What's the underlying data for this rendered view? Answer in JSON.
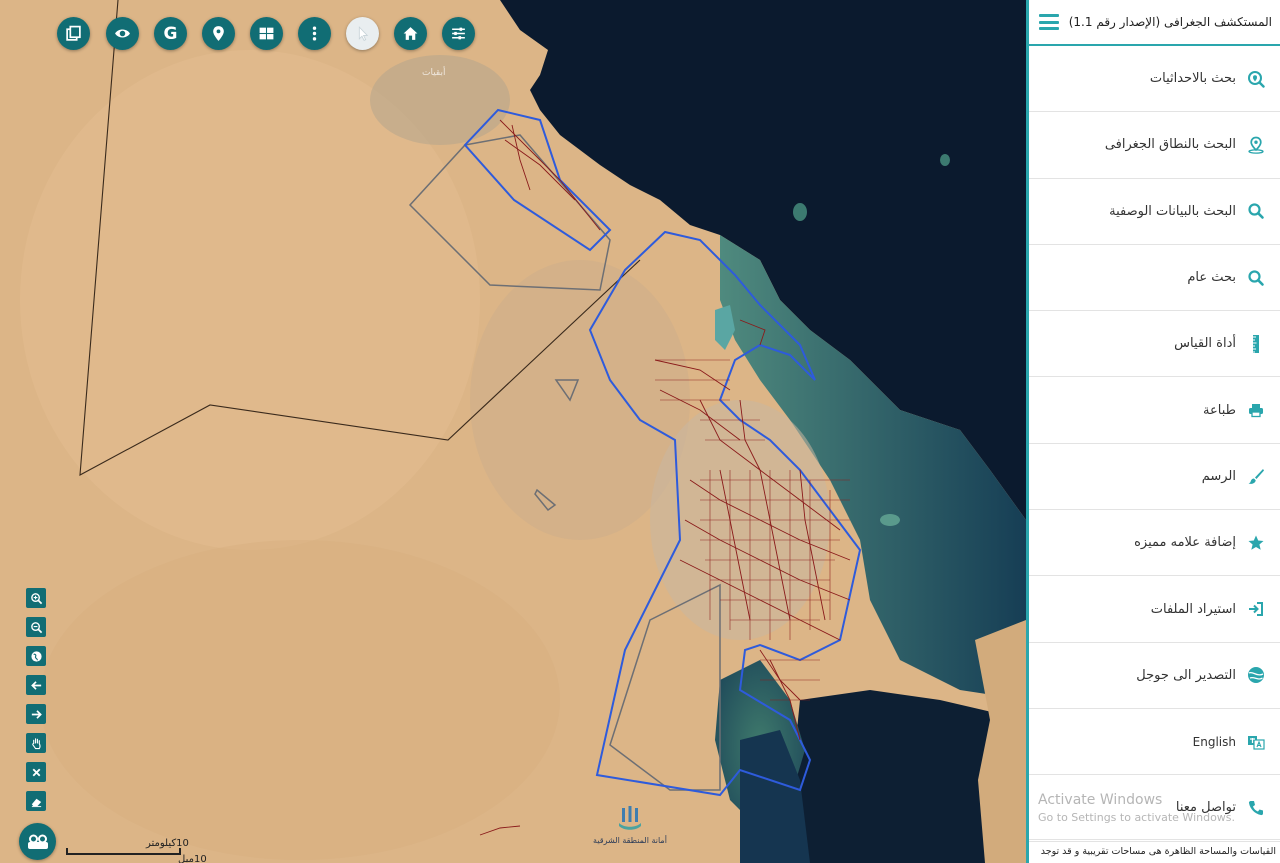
{
  "app": {
    "title": "المستكشف الجغرافى (الإصدار رقم 1.1)"
  },
  "top_toolbar": [
    {
      "name": "layers-copy",
      "icon": "layers-copy-icon"
    },
    {
      "name": "visibility",
      "icon": "eye-icon"
    },
    {
      "name": "google",
      "icon": "google-g-icon",
      "label": "G"
    },
    {
      "name": "location",
      "icon": "map-pin-icon"
    },
    {
      "name": "layout",
      "icon": "grid-icon"
    },
    {
      "name": "more",
      "icon": "vertical-dots-icon"
    },
    {
      "name": "pointer",
      "icon": "cursor-icon"
    },
    {
      "name": "home",
      "icon": "home-icon"
    },
    {
      "name": "settings",
      "icon": "sliders-icon"
    }
  ],
  "side_toolbar": [
    {
      "name": "zoom-in",
      "icon": "zoom-in-icon"
    },
    {
      "name": "zoom-out",
      "icon": "zoom-out-icon"
    },
    {
      "name": "full-extent",
      "icon": "globe-icon"
    },
    {
      "name": "previous-extent",
      "icon": "arrow-left-icon"
    },
    {
      "name": "next-extent",
      "icon": "arrow-right-icon"
    },
    {
      "name": "pan",
      "icon": "hand-icon"
    },
    {
      "name": "clear",
      "icon": "close-icon"
    },
    {
      "name": "eraser",
      "icon": "eraser-icon"
    }
  ],
  "map": {
    "scale_km": "10كيلومتر",
    "scale_mi": "10ميل",
    "logo_text": "أمانة المنطقة الشرقية",
    "label_district": "أبقيات"
  },
  "menu": [
    {
      "label": "بحث بالاحداثيات",
      "icon": "search-location-icon"
    },
    {
      "label": "البحث بالنطاق الجغرافى",
      "icon": "map-pin-area-icon"
    },
    {
      "label": "البحث بالبيانات الوصفية",
      "icon": "search-icon"
    },
    {
      "label": "بحث عام",
      "icon": "search-icon"
    },
    {
      "label": "أداة القياس",
      "icon": "ruler-icon"
    },
    {
      "label": "طباعة",
      "icon": "print-icon"
    },
    {
      "label": "الرسم",
      "icon": "brush-icon"
    },
    {
      "label": "إضافة علامه مميزه",
      "icon": "star-icon"
    },
    {
      "label": "استيراد الملفات",
      "icon": "import-icon"
    },
    {
      "label": "التصدير الى جوجل",
      "icon": "globe-earth-icon"
    },
    {
      "label": "English",
      "icon": "translate-icon"
    },
    {
      "label": "تواصل معنا",
      "icon": "phone-icon"
    }
  ],
  "windows_notice": {
    "line1": "Activate Windows",
    "line2": "Go to Settings to activate Windows."
  },
  "footer_note": "القياسات والمساحة الظاهرة هى مساحات تقريبية و قد توجد",
  "colors": {
    "accent": "#2aa6ad",
    "button": "#116d74",
    "sea": "#0b1a2e",
    "desert": "#dcb587",
    "boundary_blue": "#2e5bdc",
    "parcels_red": "#8a1a1a"
  }
}
